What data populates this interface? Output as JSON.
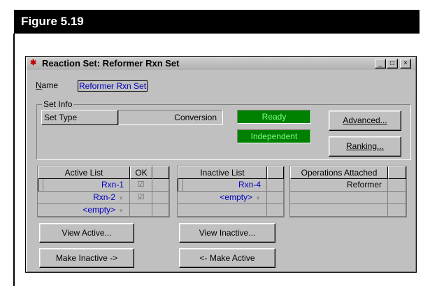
{
  "figure": {
    "title": "Figure 5.19"
  },
  "window": {
    "title": "Reaction Set: Reformer Rxn Set",
    "min_glyph": "_",
    "max_glyph": "□",
    "close_glyph": "×"
  },
  "name": {
    "label": "Name",
    "value": "Reformer Rxn Set"
  },
  "set_info": {
    "legend": "Set Info",
    "set_type_label": "Set Type",
    "set_type_value": "Conversion",
    "status_ready": "Ready",
    "status_independent": "Independent",
    "advanced_button": "Advanced...",
    "ranking_button": "Ranking..."
  },
  "active_list": {
    "header": "Active List",
    "ok_header": "OK",
    "rows": [
      {
        "name": "Rxn-1",
        "ok": "☑"
      },
      {
        "name": "Rxn-2",
        "ok": "☑"
      },
      {
        "name": "<empty>",
        "ok": ""
      }
    ]
  },
  "inactive_list": {
    "header": "Inactive List",
    "rows": [
      {
        "name": "Rxn-4"
      },
      {
        "name": "<empty>"
      }
    ]
  },
  "operations": {
    "header": "Operations Attached",
    "rows": [
      {
        "name": "Reformer"
      }
    ]
  },
  "buttons": {
    "view_active": "View Active...",
    "view_inactive": "View Inactive...",
    "make_inactive": "Make Inactive ->",
    "make_active": "<- Make Active"
  },
  "colors": {
    "status_bg": "#008000",
    "status_text": "#80ff80",
    "link_blue": "#0000c0",
    "dialog_gray": "#c0c0c0"
  }
}
